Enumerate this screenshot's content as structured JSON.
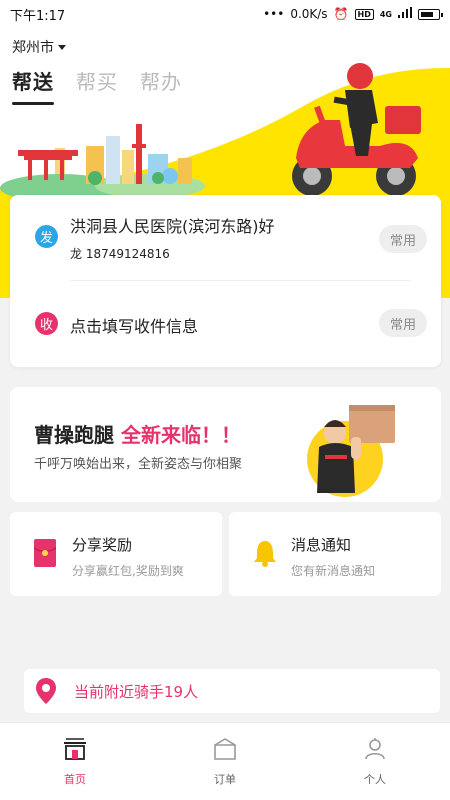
{
  "status_bar": {
    "time": "下午1:17",
    "network_speed": "0.0K/s",
    "hd": "HD",
    "signal": "4G"
  },
  "header": {
    "city": "郑州市",
    "tabs": [
      {
        "label": "帮送",
        "active": true
      },
      {
        "label": "帮买",
        "active": false
      },
      {
        "label": "帮办",
        "active": false
      }
    ]
  },
  "address_card": {
    "from": {
      "badge": "发",
      "title": "洪洞县人民医院(滨河东路)好",
      "contact": "龙 18749124816",
      "chip": "常用"
    },
    "to": {
      "badge": "收",
      "placeholder": "点击填写收件信息",
      "chip": "常用"
    }
  },
  "banner": {
    "title_main": "曹操跑腿",
    "title_highlight": "全新来临！！",
    "subtitle": "千呼万唤始出来，全新姿态与你相聚"
  },
  "cards": [
    {
      "title": "分享奖励",
      "subtitle": "分享赢红包,奖励到爽",
      "icon": "red-envelope-icon"
    },
    {
      "title": "消息通知",
      "subtitle": "您有新消息通知",
      "icon": "bell-icon"
    }
  ],
  "nearby": {
    "text": "当前附近骑手19人",
    "icon": "map-pin-icon"
  },
  "bottom_nav": [
    {
      "label": "首页",
      "icon": "home-icon",
      "active": true
    },
    {
      "label": "订单",
      "icon": "order-box-icon",
      "active": false
    },
    {
      "label": "个人",
      "icon": "person-icon",
      "active": false
    }
  ],
  "colors": {
    "accent": "#e6336b",
    "yellow": "#ffe400",
    "blue_badge": "#2aa6e6",
    "bell": "#f7c600"
  }
}
